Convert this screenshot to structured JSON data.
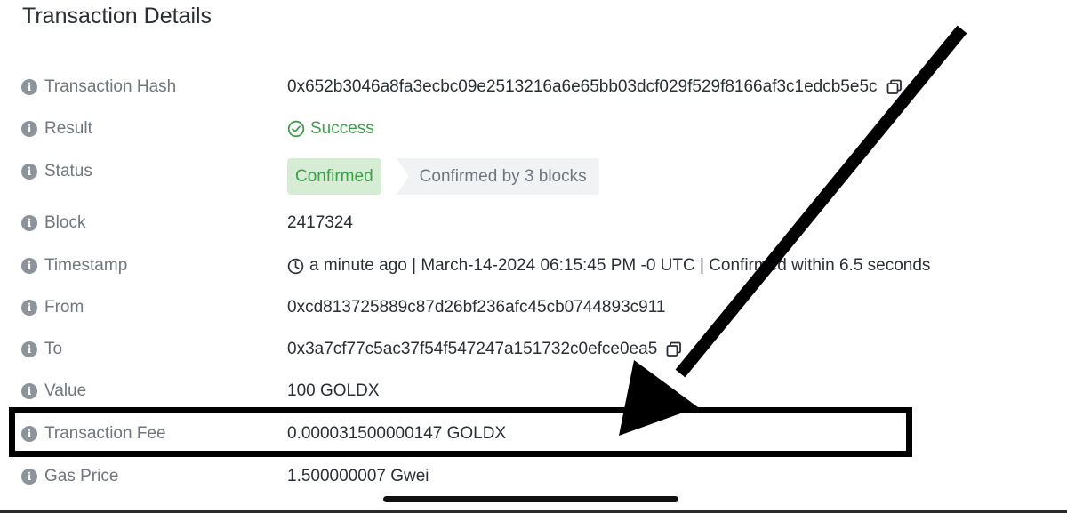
{
  "title": "Transaction Details",
  "rows": {
    "hash": {
      "label": "Transaction Hash",
      "value": "0x652b3046a8fa3ecbc09e2513216a6e65bb03dcf029f529f8166af3c1edcb5e5c"
    },
    "result": {
      "label": "Result",
      "value": "Success"
    },
    "status": {
      "label": "Status",
      "badge": "Confirmed",
      "blocks": "Confirmed by 3 blocks"
    },
    "block": {
      "label": "Block",
      "value": "2417324"
    },
    "timestamp": {
      "label": "Timestamp",
      "value": "a minute ago | March-14-2024 06:15:45 PM -0 UTC | Confirmed within 6.5 seconds"
    },
    "from": {
      "label": "From",
      "value": "0xcd813725889c87d26bf236afc45cb0744893c911"
    },
    "to": {
      "label": "To",
      "value": "0x3a7cf77c5ac37f54f547247a151732c0efce0ea5"
    },
    "value": {
      "label": "Value",
      "value": "100 GOLDX"
    },
    "fee": {
      "label": "Transaction Fee",
      "value": "0.000031500000147 GOLDX"
    },
    "gas": {
      "label": "Gas Price",
      "value": "1.500000007 Gwei"
    }
  },
  "icons": {
    "info": "info-circle-icon",
    "copy": "copy-icon",
    "success": "check-circle-icon",
    "time": "clock-icon",
    "annotation": "arrow"
  },
  "colors": {
    "success": "#3d9f4b",
    "badge_bg": "#d6ecd4",
    "label": "#6f767e",
    "text": "#2a2f36",
    "annotation": "#000000"
  }
}
